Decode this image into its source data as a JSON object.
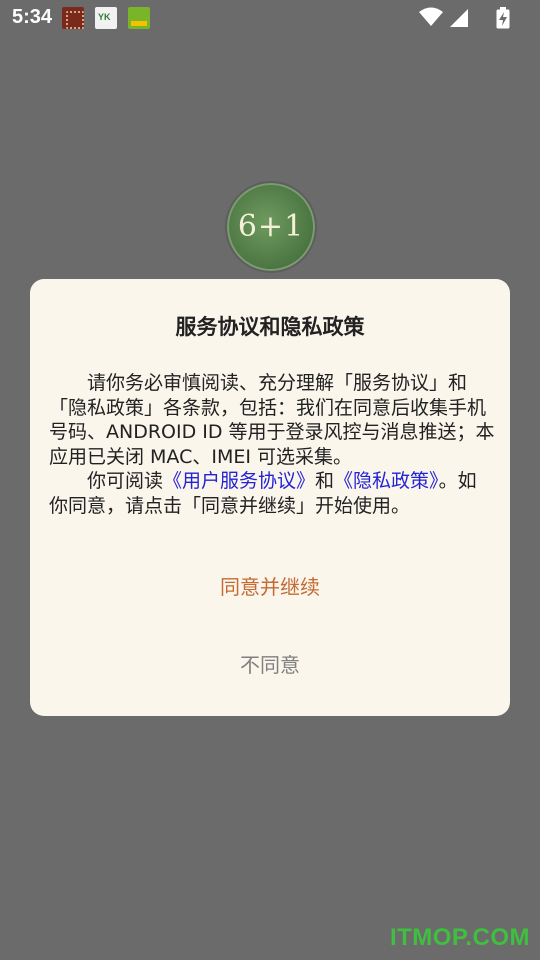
{
  "status_bar": {
    "time": "5:34",
    "notifications": [
      "app-notification-icon-1",
      "yk-app-icon",
      "green-app-icon"
    ],
    "system_icons": [
      "wifi-icon",
      "signal-icon",
      "battery-charging-icon"
    ]
  },
  "app_logo": {
    "text": "6+1",
    "color": "#4f7a45"
  },
  "dialog": {
    "title": "服务协议和隐私政策",
    "paragraph_1": "请你务必审慎阅读、充分理解「服务协议」和「隐私政策」各条款，包括：我们在同意后收集手机号码、ANDROID ID 等用于登录风控与消息推送；本应用已关闭 MAC、IMEI 可选采集。",
    "paragraph_2_prefix": "你可阅读",
    "link_user_agreement": "《用户服务协议》",
    "paragraph_2_and": "和",
    "link_privacy_policy": "《隐私政策》",
    "paragraph_2_suffix": "。如你同意，请点击「同意并继续」开始使用。",
    "agree_label": "同意并继续",
    "disagree_label": "不同意",
    "link_color": "#2323d6",
    "agree_color": "#c46a32"
  },
  "watermark": "ITMOP.COM"
}
